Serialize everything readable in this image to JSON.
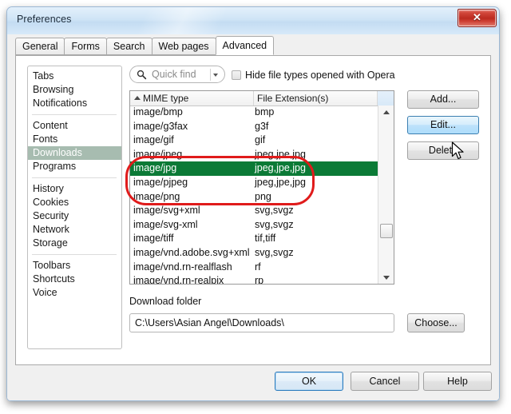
{
  "window": {
    "title": "Preferences",
    "close_label": "✕"
  },
  "tabs": [
    {
      "label": "General",
      "active": false
    },
    {
      "label": "Forms",
      "active": false
    },
    {
      "label": "Search",
      "active": false
    },
    {
      "label": "Web pages",
      "active": false
    },
    {
      "label": "Advanced",
      "active": true
    }
  ],
  "sidebar": {
    "groups": [
      {
        "items": [
          {
            "label": "Tabs",
            "selected": false
          },
          {
            "label": "Browsing",
            "selected": false
          },
          {
            "label": "Notifications",
            "selected": false
          }
        ]
      },
      {
        "items": [
          {
            "label": "Content",
            "selected": false
          },
          {
            "label": "Fonts",
            "selected": false
          },
          {
            "label": "Downloads",
            "selected": true
          },
          {
            "label": "Programs",
            "selected": false
          }
        ]
      },
      {
        "items": [
          {
            "label": "History",
            "selected": false
          },
          {
            "label": "Cookies",
            "selected": false
          },
          {
            "label": "Security",
            "selected": false
          },
          {
            "label": "Network",
            "selected": false
          },
          {
            "label": "Storage",
            "selected": false
          }
        ]
      },
      {
        "items": [
          {
            "label": "Toolbars",
            "selected": false
          },
          {
            "label": "Shortcuts",
            "selected": false
          },
          {
            "label": "Voice",
            "selected": false
          }
        ]
      }
    ]
  },
  "toolbar": {
    "quick_find_placeholder": "Quick find",
    "quick_find_value": "",
    "hide_checkbox_label": "Hide file types opened with Opera",
    "hide_checkbox_checked": false
  },
  "table": {
    "columns": [
      "MIME type",
      "File Extension(s)"
    ],
    "sort_column": "MIME type",
    "sort_direction": "ascending",
    "rows": [
      {
        "mime": "image/bmp",
        "ext": "bmp",
        "selected": false
      },
      {
        "mime": "image/g3fax",
        "ext": "g3f",
        "selected": false
      },
      {
        "mime": "image/gif",
        "ext": "gif",
        "selected": false
      },
      {
        "mime": "image/jpeg",
        "ext": "jpeg,jpe,jpg",
        "selected": false
      },
      {
        "mime": "image/jpg",
        "ext": "jpeg,jpe,jpg",
        "selected": true
      },
      {
        "mime": "image/pjpeg",
        "ext": "jpeg,jpe,jpg",
        "selected": false
      },
      {
        "mime": "image/png",
        "ext": "png",
        "selected": false
      },
      {
        "mime": "image/svg+xml",
        "ext": "svg,svgz",
        "selected": false
      },
      {
        "mime": "image/svg-xml",
        "ext": "svg,svgz",
        "selected": false
      },
      {
        "mime": "image/tiff",
        "ext": "tif,tiff",
        "selected": false
      },
      {
        "mime": "image/vnd.adobe.svg+xml",
        "ext": "svg,svgz",
        "selected": false
      },
      {
        "mime": "image/vnd.rn-realflash",
        "ext": "rf",
        "selected": false
      },
      {
        "mime": "image/vnd.rn-realpix",
        "ext": "rp",
        "selected": false
      }
    ]
  },
  "side_buttons": {
    "add": "Add...",
    "edit": "Edit...",
    "delete": "Delete",
    "edit_state": "hover"
  },
  "download_folder": {
    "label": "Download folder",
    "value": "C:\\Users\\Asian Angel\\Downloads\\",
    "choose": "Choose..."
  },
  "footer": {
    "ok": "OK",
    "cancel": "Cancel",
    "help": "Help",
    "default_button": "OK"
  },
  "colors": {
    "selection_green": "#0b7a36",
    "sidebar_selection": "#a7bcb0",
    "annotation_red": "#e01b1b",
    "titlebar_blue": "#cfe4f6",
    "close_red": "#bb2b20"
  }
}
